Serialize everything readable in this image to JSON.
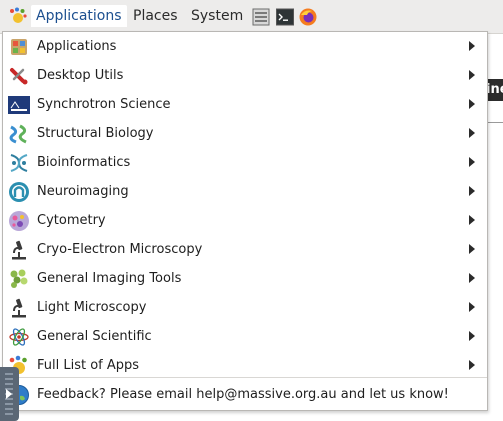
{
  "panel": {
    "menus": [
      "Applications",
      "Places",
      "System"
    ],
    "logo_icon": "gnome-foot-icon",
    "launchers": [
      "file-manager-icon",
      "terminal-icon",
      "firefox-icon"
    ]
  },
  "background_window": {
    "text": "ine"
  },
  "menu": {
    "items": [
      {
        "label": "Applications",
        "icon": "applications-icon",
        "submenu": true
      },
      {
        "label": "Desktop Utils",
        "icon": "desktop-utils-icon",
        "submenu": true
      },
      {
        "label": "Synchrotron Science",
        "icon": "ansto-icon",
        "submenu": true
      },
      {
        "label": "Structural Biology",
        "icon": "structural-biology-icon",
        "submenu": true
      },
      {
        "label": "Bioinformatics",
        "icon": "bioinformatics-icon",
        "submenu": true
      },
      {
        "label": "Neuroimaging",
        "icon": "neuroimaging-icon",
        "submenu": true
      },
      {
        "label": "Cytometry",
        "icon": "cytometry-icon",
        "submenu": true
      },
      {
        "label": "Cryo-Electron Microscopy",
        "icon": "microscope-icon",
        "submenu": true
      },
      {
        "label": "General Imaging Tools",
        "icon": "imaging-tools-icon",
        "submenu": true
      },
      {
        "label": "Light Microscopy",
        "icon": "microscope-icon",
        "submenu": true
      },
      {
        "label": "General Scientific",
        "icon": "atom-icon",
        "submenu": true
      },
      {
        "label": "Full List of Apps",
        "icon": "applications-icon",
        "submenu": true
      }
    ],
    "feedback": {
      "label": "Feedback? Please email help@massive.org.au and let us know!",
      "icon": "globe-icon"
    }
  },
  "colors": {
    "accent": "#1c4f8f",
    "panel_bg": "#edeceb",
    "menu_bg": "#ffffff"
  }
}
